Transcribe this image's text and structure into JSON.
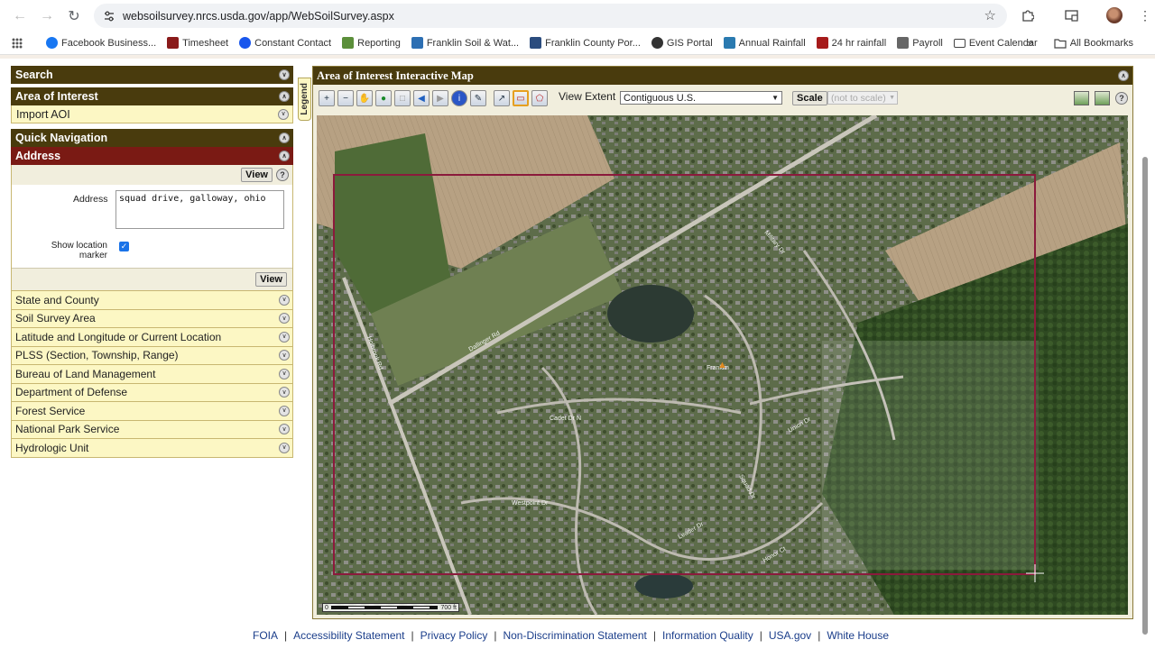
{
  "browser": {
    "url": "websoilsurvey.nrcs.usda.gov/app/WebSoilSurvey.aspx",
    "bookmarks": [
      {
        "label": "Facebook Business...",
        "icon": "meta-icon",
        "color": "#1877f2"
      },
      {
        "label": "Timesheet",
        "icon": "timesheet-icon",
        "color": "#8a1a1a"
      },
      {
        "label": "Constant Contact",
        "icon": "constant-contact-icon",
        "color": "#1856ed"
      },
      {
        "label": "Reporting",
        "icon": "reporting-icon",
        "color": "#5b8f3a"
      },
      {
        "label": "Franklin Soil & Wat...",
        "icon": "franklin-soil-icon",
        "color": "#2d6fb3"
      },
      {
        "label": "Franklin County Por...",
        "icon": "franklin-county-icon",
        "color": "#2b4c7e"
      },
      {
        "label": "GIS Portal",
        "icon": "gis-portal-icon",
        "color": "#333333"
      },
      {
        "label": "Annual Rainfall",
        "icon": "annual-rainfall-icon",
        "color": "#2a7ab0"
      },
      {
        "label": "24 hr rainfall",
        "icon": "rainfall-24hr-icon",
        "color": "#a61b1b"
      },
      {
        "label": "Payroll",
        "icon": "payroll-icon",
        "color": "#666666"
      },
      {
        "label": "Event Calendar",
        "icon": "folder-icon",
        "color": "#444444"
      }
    ],
    "all_bookmarks": "All Bookmarks"
  },
  "left_panel": {
    "search_title": "Search",
    "aoi_title": "Area of Interest",
    "import_aoi": "Import AOI",
    "quick_nav_title": "Quick Navigation",
    "address_title": "Address",
    "view_label": "View",
    "address_label": "Address",
    "address_value": "squad drive, galloway, ohio",
    "show_marker_label": "Show location marker",
    "show_marker_checked": true,
    "nav_items": [
      "State and County",
      "Soil Survey Area",
      "Latitude and Longitude or Current Location",
      "PLSS (Section, Township, Range)",
      "Bureau of Land Management",
      "Department of Defense",
      "Forest Service",
      "National Park Service",
      "Hydrologic Unit"
    ]
  },
  "map_panel": {
    "title": "Area of Interest Interactive Map",
    "legend_tab": "Legend",
    "view_extent_label": "View Extent",
    "view_extent_value": "Contiguous U.S.",
    "scale_button": "Scale",
    "scale_value": "(not to scale)",
    "scalebar_left": "0",
    "scalebar_right": "700 ft",
    "aoi_rect_color": "#8b1a3c",
    "map_labels": [
      "Dallinger Rd",
      "Cadet Dr N",
      "Westpoint Dr",
      "Leader Dr",
      "Military Dr",
      "Franklin",
      "Union Dr",
      "Squad Dr",
      "Honor Ct",
      "Holbrook Rd"
    ]
  },
  "footer": {
    "links": [
      "FOIA",
      "Accessibility Statement",
      "Privacy Policy",
      "Non-Discrimination Statement",
      "Information Quality",
      "USA.gov",
      "White House"
    ]
  },
  "colors": {
    "panel_header": "#493b0d",
    "active_header": "#7a1a14",
    "panel_light": "#fcf7c4",
    "link": "#1a3d8a"
  }
}
